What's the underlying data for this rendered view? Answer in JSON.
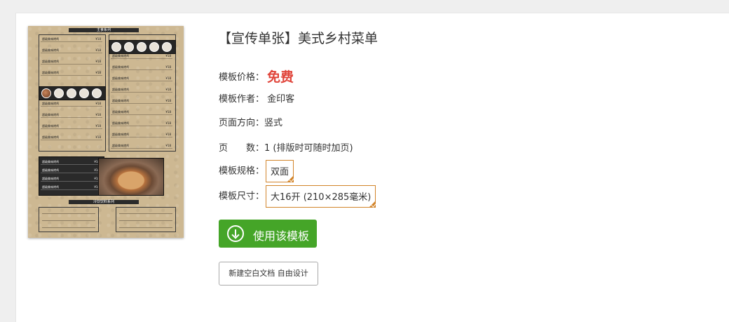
{
  "thumbnail": {
    "header_main": "主食系列",
    "header_drinks": "冷饮饮料系列",
    "dish_name": "超级美味烤鸡",
    "dish_price": "¥18"
  },
  "template": {
    "title": "【宣传单张】美式乡村菜单",
    "price_label": "模板价格：",
    "price_value": "免费",
    "author_label": "模板作者：",
    "author_value": "金印客",
    "orientation_label": "页面方向：",
    "orientation_value": "竖式",
    "pages_label": "页　　数：",
    "pages_value": "1 (排版时可随时加页)",
    "spec_label": "模板规格：",
    "spec_value": "双面",
    "size_label": "模板尺寸：",
    "size_value": "大16开 (210×285毫米)"
  },
  "actions": {
    "use_label": "使用该模板",
    "blank_label": "新建空白文档 自由设计"
  },
  "colors": {
    "accent_green": "#45a528",
    "price_red": "#e0443a",
    "tag_orange": "#d2842a"
  }
}
